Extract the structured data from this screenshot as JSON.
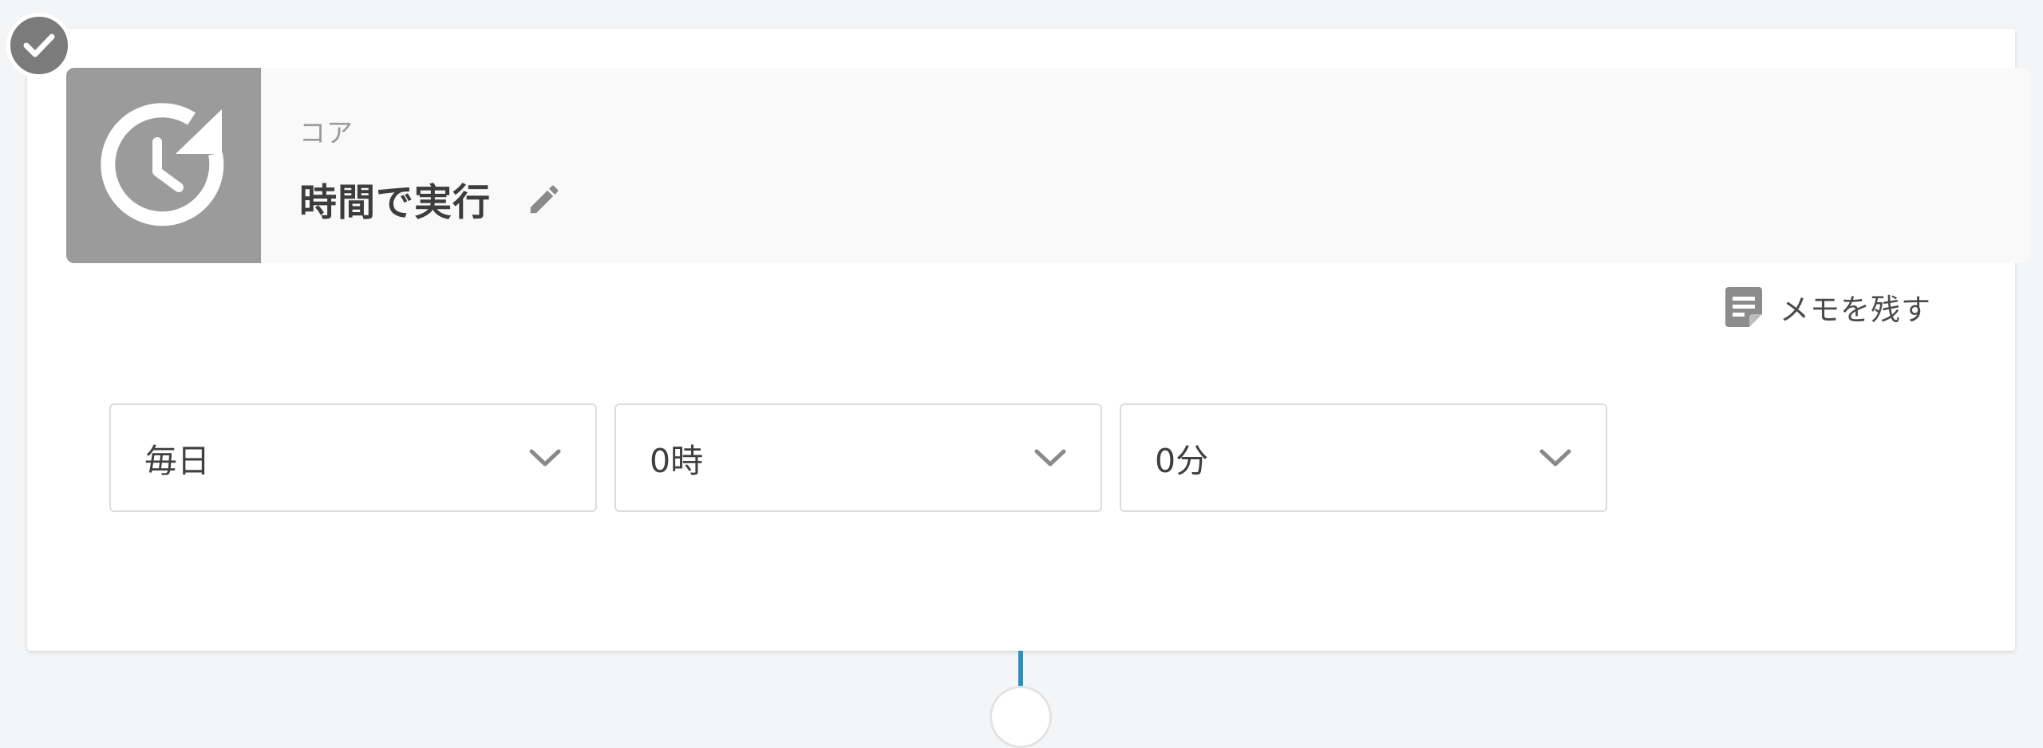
{
  "step": {
    "category": "コア",
    "title": "時間で実行",
    "status_icon": "check-icon",
    "header_icon": "clock-refresh-icon",
    "edit_icon": "pencil-icon"
  },
  "memo": {
    "label": "メモを残す",
    "icon": "note-icon"
  },
  "schedule": {
    "frequency": {
      "value": "毎日"
    },
    "hour": {
      "value": "0時"
    },
    "minute": {
      "value": "0分"
    }
  },
  "colors": {
    "header_icon_bg": "#9b9b9b",
    "connector": "#2a8fba",
    "badge": "#7b7b7b"
  }
}
